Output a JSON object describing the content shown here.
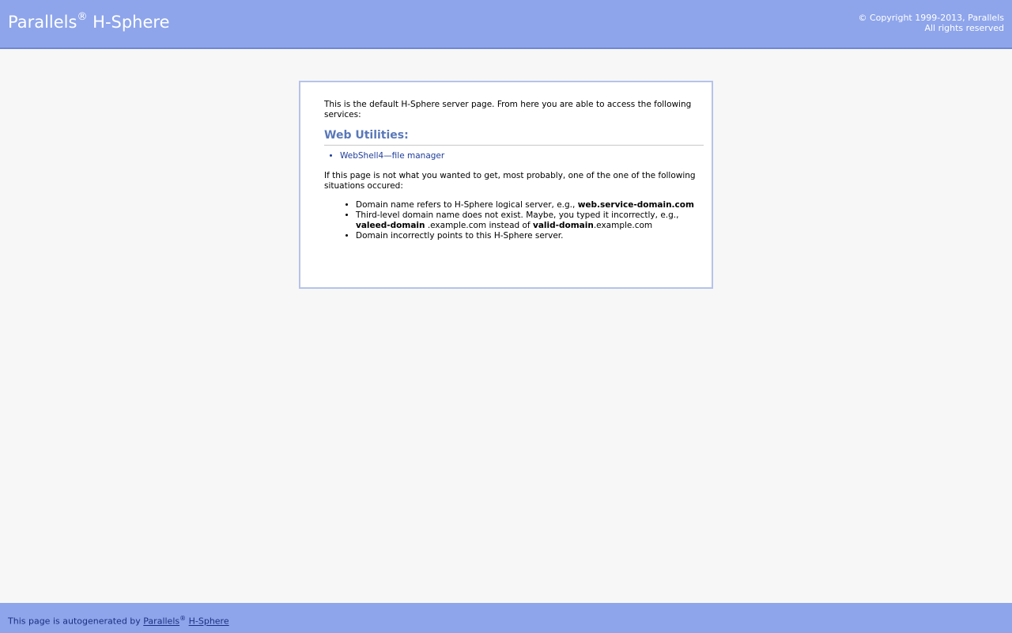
{
  "header": {
    "brand_name": "Parallels",
    "brand_mark": "®",
    "brand_product": "H-Sphere",
    "copyright_line1": "© Copyright 1999-2013, Parallels",
    "copyright_line2": "All rights reserved"
  },
  "main": {
    "intro": "This is the default H-Sphere server page. From here you are able to access the following services:",
    "section_title": "Web Utilities:",
    "links": [
      {
        "label": "WebShell4—file manager"
      }
    ],
    "explanation": "If this page is not what you wanted to get, most probably, one of the one of the following situations occured:",
    "situations": [
      {
        "text": "Domain name refers to H-Sphere logical server, e.g., ",
        "bold": "web.service-domain.com"
      },
      {
        "text": "Third-level domain name does not exist. Maybe, you typed it incorrectly, e.g., ",
        "bold1": "valeed-domain",
        "mid": " .example.com instead of ",
        "bold2": "valid-domain",
        "tail": ".example.com"
      },
      {
        "text": "Domain incorrectly points to this H-Sphere server."
      }
    ]
  },
  "footer": {
    "prefix": "This page is autogenerated by ",
    "link1": "Parallels",
    "mark": "®",
    "link2": "H-Sphere"
  },
  "colors": {
    "header_bg": "#8ea5eb",
    "section_title": "#5a78b8",
    "link": "#1f3d99"
  }
}
